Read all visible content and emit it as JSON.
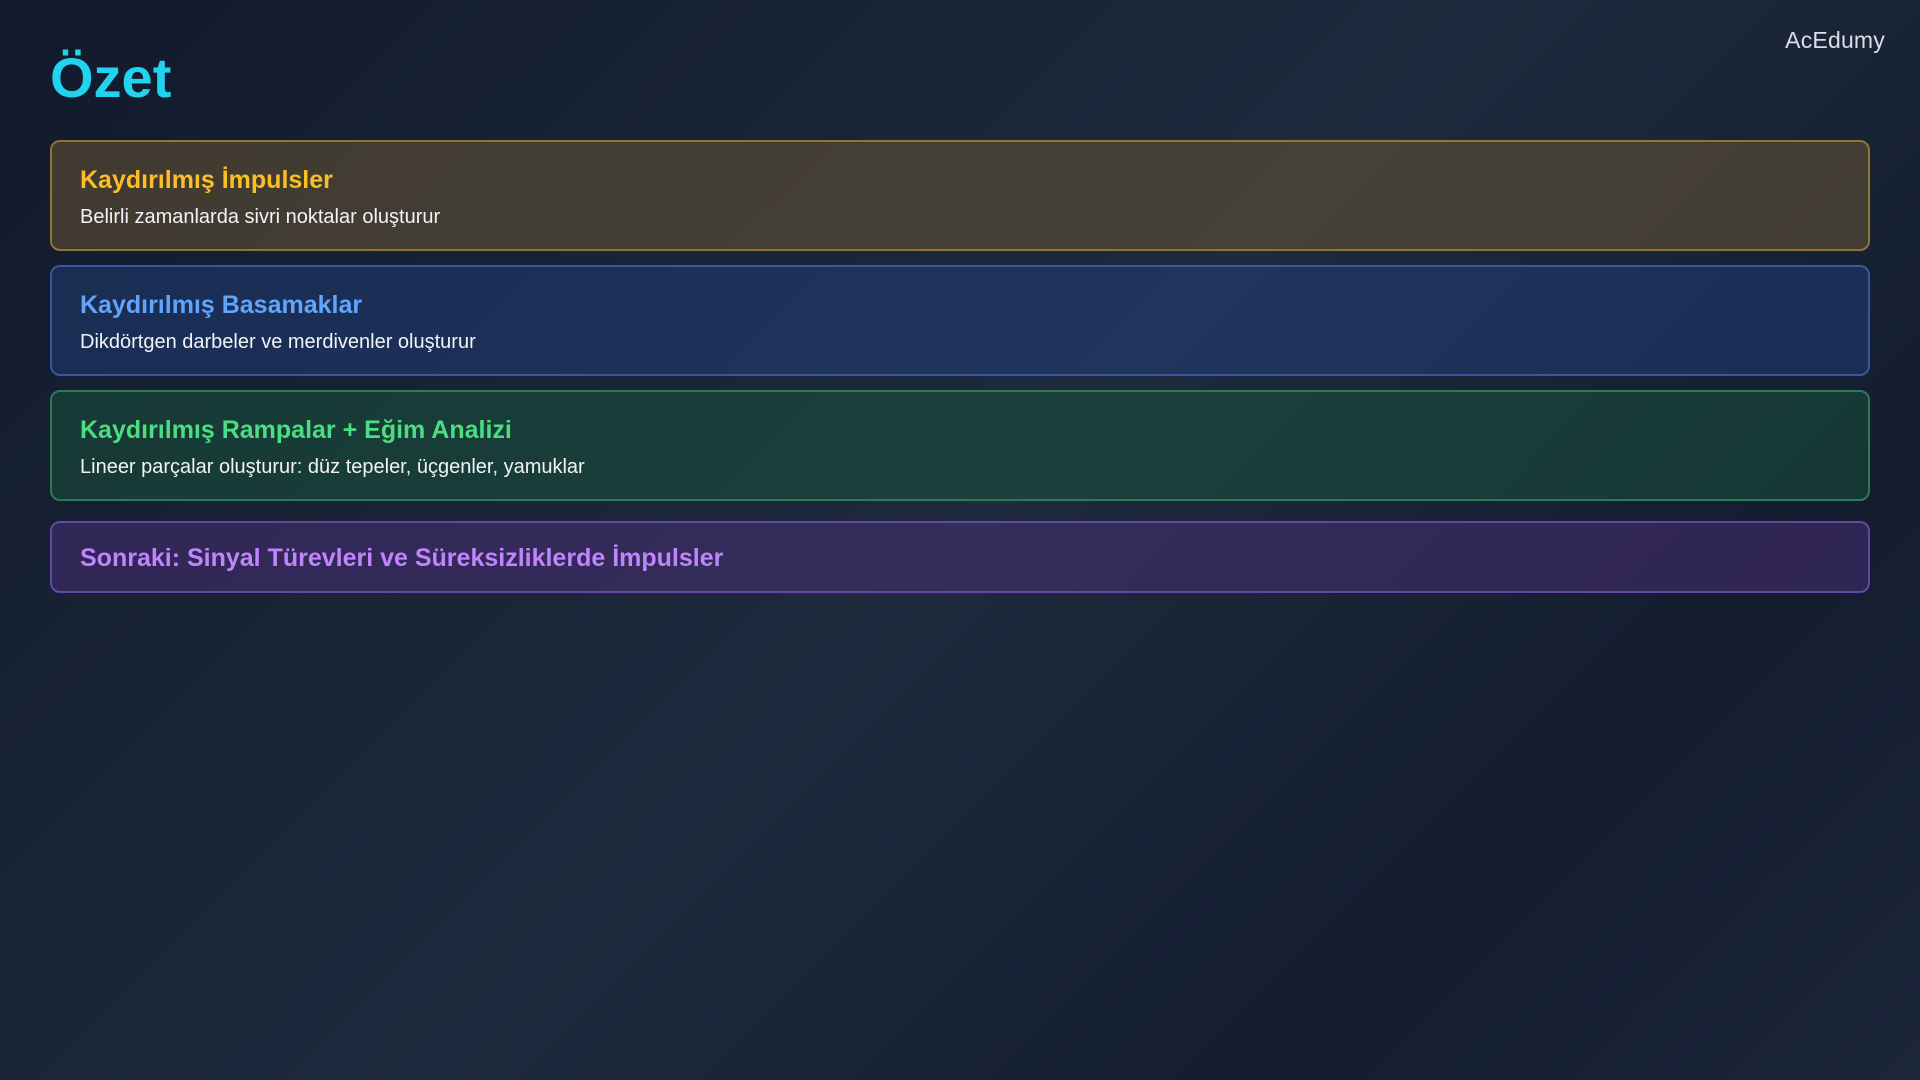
{
  "brand": "AcEdumy",
  "title": "Özet",
  "cards": [
    {
      "title": "Kaydırılmış İmpulsler",
      "description": "Belirli zamanlarda sivri noktalar oluşturur",
      "accent": "#fbbf24"
    },
    {
      "title": "Kaydırılmış Basamaklar",
      "description": "Dikdörtgen darbeler ve merdivenler oluşturur",
      "accent": "#60a5fa"
    },
    {
      "title": "Kaydırılmış Rampalar + Eğim Analizi",
      "description": "Lineer parçalar oluşturur: düz tepeler, üçgenler, yamuklar",
      "accent": "#4ade80"
    }
  ],
  "next": {
    "title": "Sonraki: Sinyal Türevleri ve Süreksizliklerde İmpulsler",
    "accent": "#c084fc"
  }
}
